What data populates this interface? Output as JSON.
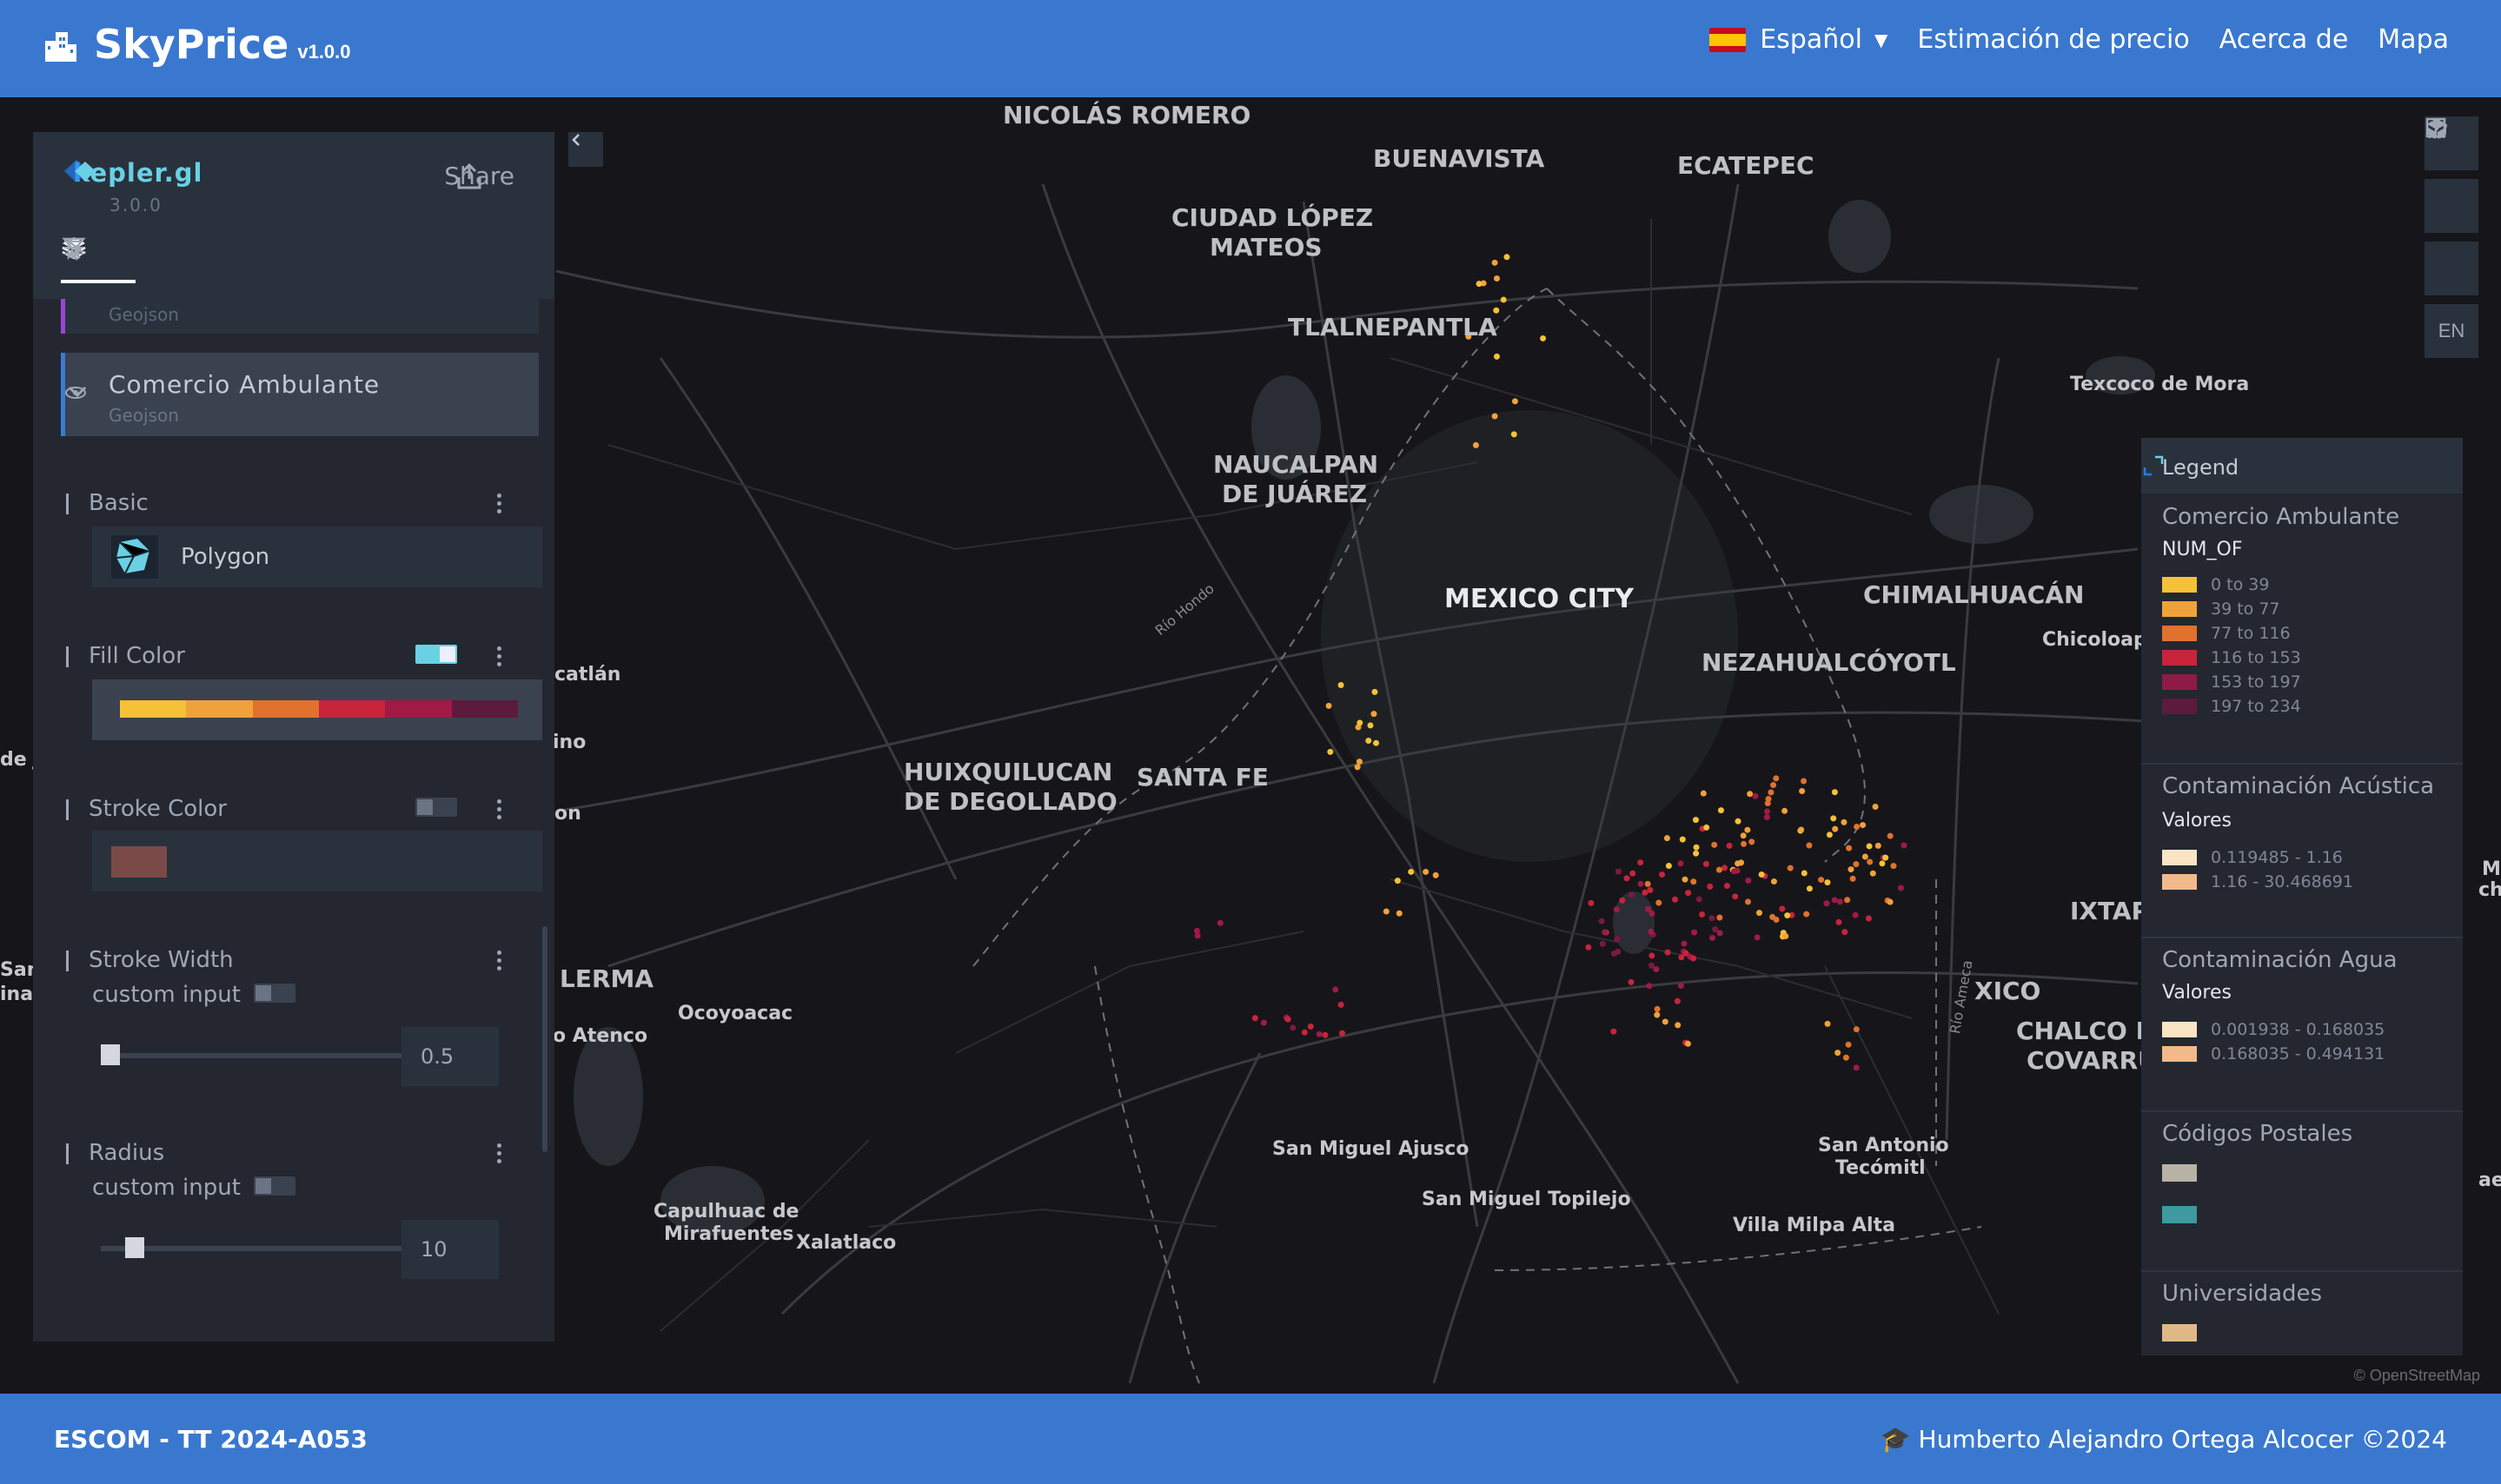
{
  "header": {
    "app_name": "SkyPrice",
    "version": "v1.0.0",
    "language": "Español",
    "nav": [
      "Estimación de precio",
      "Acerca de",
      "Mapa"
    ],
    "bg_color": "#3a78cf"
  },
  "map": {
    "places": [
      {
        "text": "NICOLÁS ROMERO",
        "cls": "med"
      },
      {
        "text": "BUENAVISTA",
        "cls": "med"
      },
      {
        "text": "ECATEPEC",
        "cls": "med"
      },
      {
        "text": "CIUDAD LÓPEZ",
        "cls": "med"
      },
      {
        "text": "MATEOS",
        "cls": "med"
      },
      {
        "text": "TLALNEPANTLA",
        "cls": "med"
      },
      {
        "text": "Texcoco de Mora",
        "cls": "sm"
      },
      {
        "text": "NAUCALPAN",
        "cls": "med"
      },
      {
        "text": "DE JUÁREZ",
        "cls": "med"
      },
      {
        "text": "MEXICO CITY",
        "cls": "big"
      },
      {
        "text": "CHIMALHUACÁN",
        "cls": "med"
      },
      {
        "text": "Chicoloapa",
        "cls": "sm"
      },
      {
        "text": "NEZAHUALCÓYOTL",
        "cls": "med"
      },
      {
        "text": "catlán",
        "cls": "sm"
      },
      {
        "text": "ino",
        "cls": "sm"
      },
      {
        "text": "de J",
        "cls": "sm"
      },
      {
        "text": "HUIXQUILUCAN",
        "cls": "med"
      },
      {
        "text": "DE DEGOLLADO",
        "cls": "med"
      },
      {
        "text": "SANTA FE",
        "cls": "med"
      },
      {
        "text": "on",
        "cls": "sm"
      },
      {
        "text": "IXTAP",
        "cls": "med"
      },
      {
        "text": "LERMA",
        "cls": "med"
      },
      {
        "text": "Ocoyoacac",
        "cls": "sm"
      },
      {
        "text": "o Atenco",
        "cls": "sm"
      },
      {
        "text": "XICO",
        "cls": "med"
      },
      {
        "text": "CHALCO DI",
        "cls": "med"
      },
      {
        "text": "COVARRU",
        "cls": "med"
      },
      {
        "text": "San Miguel Ajusco",
        "cls": "sm"
      },
      {
        "text": "San Antonio",
        "cls": "sm"
      },
      {
        "text": "Tecómitl",
        "cls": "sm"
      },
      {
        "text": "San Miguel Topilejo",
        "cls": "sm"
      },
      {
        "text": "Villa Milpa Alta",
        "cls": "sm"
      },
      {
        "text": "Capulhuac de",
        "cls": "sm"
      },
      {
        "text": "Mirafuentes",
        "cls": "sm"
      },
      {
        "text": "Xalatlaco",
        "cls": "sm"
      },
      {
        "text": "Río Hondo",
        "cls": "river"
      },
      {
        "text": "Río Ameca",
        "cls": "river"
      },
      {
        "text": "San",
        "cls": "sm"
      },
      {
        "text": "inac",
        "cls": "sm"
      },
      {
        "text": "M",
        "cls": "sm"
      },
      {
        "text": "ch",
        "cls": "sm"
      },
      {
        "text": "ae",
        "cls": "sm"
      }
    ],
    "attribution": "© OpenStreetMap"
  },
  "kepler": {
    "name": "kepler.gl",
    "version": "3.0.0",
    "share": "Share",
    "prev_layer_sub": "Geojson",
    "layer": {
      "title": "Comercio Ambulante",
      "sub": "Geojson"
    },
    "basic": "Basic",
    "polygon": "Polygon",
    "fill_color": "Fill Color",
    "fill_ramp": [
      "#f5c137",
      "#f0a23a",
      "#e0722e",
      "#c8243c",
      "#a01a45",
      "#5c1a3c"
    ],
    "stroke_color": "Stroke Color",
    "stroke_swatch": "#7a4a48",
    "stroke_width": "Stroke Width",
    "custom_input": "custom input",
    "stroke_width_value": "0.5",
    "radius": "Radius",
    "radius_value": "10"
  },
  "legend": {
    "title": "Legend",
    "layers": [
      {
        "name": "Comercio Ambulante",
        "field": "NUM_OF",
        "items": [
          {
            "label": "0 to 39",
            "color": "#f5c137"
          },
          {
            "label": "39 to 77",
            "color": "#f0a23a"
          },
          {
            "label": "77 to 116",
            "color": "#e0722e"
          },
          {
            "label": "116 to 153",
            "color": "#c8243c"
          },
          {
            "label": "153 to 197",
            "color": "#8e1b45"
          },
          {
            "label": "197 to 234",
            "color": "#5c1a3c"
          }
        ]
      },
      {
        "name": "Contaminación Acústica",
        "field": "Valores",
        "items": [
          {
            "label": "0.119485 - 1.16",
            "color": "#fbe4c4"
          },
          {
            "label": "1.16 - 30.468691",
            "color": "#f2b98a"
          }
        ]
      },
      {
        "name": "Contaminación Agua",
        "field": "Valores",
        "items": [
          {
            "label": "0.001938 - 0.168035",
            "color": "#fbe4c4"
          },
          {
            "label": "0.168035 - 0.494131",
            "color": "#f2b98a"
          }
        ]
      },
      {
        "name": "Códigos Postales",
        "swatches": [
          "#b8b2a4",
          "#3c9aa0"
        ]
      },
      {
        "name": "Universidades",
        "swatches": [
          "#e0b888"
        ]
      }
    ]
  },
  "map_controls": {
    "lang": "EN"
  },
  "footer": {
    "left": "ESCOM - TT 2024-A053",
    "right": "🎓 Humberto Alejandro Ortega Alcocer ©2024"
  }
}
